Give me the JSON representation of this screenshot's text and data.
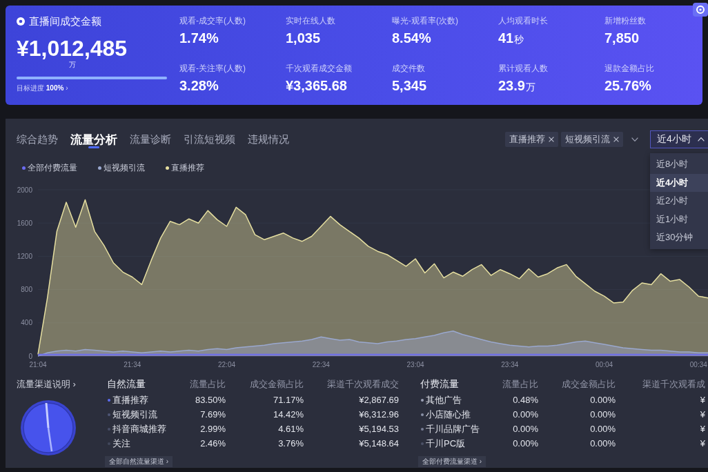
{
  "summary": {
    "title": "直播间成交金额",
    "value": "¥1,012,485",
    "unit": "万",
    "progress": {
      "level": 1.0
    },
    "goal_link": "目标进度 **100%** ›",
    "metrics": [
      {
        "label": "观看-成交率(人数)",
        "value": "1.74%"
      },
      {
        "label": "实时在线人数",
        "value": "1,035"
      },
      {
        "label": "曝光-观看率(次数)",
        "value": "8.54%"
      },
      {
        "label": "人均观看时长",
        "value": "41",
        "unit": "秒"
      },
      {
        "label": "新增粉丝数",
        "value": "7,850"
      },
      {
        "label": "观看-关注率(人数)",
        "value": "3.28%"
      },
      {
        "label": "千次观看成交金额",
        "value": "¥3,365.68"
      },
      {
        "label": "成交件数",
        "value": "5,345"
      },
      {
        "label": "累计观看人数",
        "value": "23.9",
        "unit": "万"
      },
      {
        "label": "退款金额占比",
        "value": "25.76%"
      }
    ]
  },
  "tabs": [
    {
      "label": "综合趋势",
      "selected": false
    },
    {
      "label": "流量分析",
      "selected": true
    },
    {
      "label": "流量诊断",
      "selected": false
    },
    {
      "label": "引流短视频",
      "selected": false
    },
    {
      "label": "违规情况",
      "selected": false
    }
  ],
  "filters": {
    "tags": [
      "直播推荐",
      "短视频引流"
    ]
  },
  "time_range": {
    "value": "近4小时",
    "expanded": true,
    "options": [
      {
        "label": "近8小时",
        "selected": false
      },
      {
        "label": "近4小时",
        "selected": true
      },
      {
        "label": "近2小时",
        "selected": false
      },
      {
        "label": "近1小时",
        "selected": false
      },
      {
        "label": "近30分钟",
        "selected": false
      }
    ]
  },
  "traffic_chart": {
    "chart_data": {
      "type": "area",
      "categories": [
        "21:04",
        null,
        null,
        null,
        null,
        null,
        null,
        null,
        null,
        null,
        "21:34",
        null,
        null,
        null,
        null,
        null,
        null,
        null,
        null,
        null,
        "22:04",
        null,
        null,
        null,
        null,
        null,
        null,
        null,
        null,
        null,
        "22:34",
        null,
        null,
        null,
        null,
        null,
        null,
        null,
        null,
        null,
        "23:04",
        null,
        null,
        null,
        null,
        null,
        null,
        null,
        null,
        null,
        "23:34",
        null,
        null,
        null,
        null,
        null,
        null,
        null,
        null,
        null,
        "00:04",
        null,
        null,
        null,
        null,
        null,
        null,
        null,
        null,
        null,
        "00:34",
        null
      ],
      "series": [
        {
          "name": "全部付费流量",
          "color": "#6c6cf2",
          "values": [
            20,
            20,
            20,
            20,
            20,
            20,
            20,
            20,
            20,
            20,
            20,
            20,
            20,
            20,
            20,
            20,
            20,
            20,
            20,
            20,
            20,
            20,
            20,
            20,
            20,
            20,
            20,
            20,
            20,
            20,
            20,
            20,
            20,
            20,
            20,
            20,
            20,
            20,
            20,
            20,
            20,
            20,
            20,
            20,
            20,
            20,
            20,
            20,
            20,
            20,
            20,
            20,
            20,
            20,
            20,
            20,
            20,
            20,
            20,
            20,
            20,
            20,
            20,
            20,
            20,
            20,
            20,
            20,
            20,
            20,
            20,
            20
          ]
        },
        {
          "name": "短视频引流",
          "color": "#9aa8cf",
          "values": [
            0,
            40,
            60,
            70,
            60,
            80,
            70,
            60,
            50,
            60,
            50,
            40,
            50,
            60,
            50,
            60,
            70,
            60,
            80,
            90,
            80,
            100,
            110,
            120,
            130,
            150,
            160,
            170,
            180,
            200,
            230,
            210,
            190,
            200,
            170,
            160,
            150,
            170,
            180,
            200,
            210,
            230,
            250,
            280,
            300,
            260,
            230,
            200,
            170,
            150,
            130,
            120,
            110,
            120,
            120,
            130,
            150,
            170,
            180,
            160,
            140,
            120,
            100,
            90,
            80,
            70,
            70,
            60,
            50,
            50,
            40,
            40
          ]
        },
        {
          "name": "直播推荐",
          "color": "#e6dfa0",
          "values": [
            20,
            700,
            1500,
            1850,
            1550,
            1880,
            1500,
            1330,
            1120,
            1010,
            950,
            860,
            1150,
            1420,
            1620,
            1580,
            1650,
            1600,
            1750,
            1640,
            1560,
            1790,
            1700,
            1460,
            1400,
            1440,
            1480,
            1420,
            1380,
            1440,
            1560,
            1680,
            1580,
            1500,
            1420,
            1320,
            1260,
            1220,
            1150,
            1080,
            1170,
            1000,
            1110,
            940,
            1010,
            960,
            1040,
            1100,
            970,
            1040,
            990,
            930,
            1050,
            950,
            990,
            1060,
            1100,
            960,
            870,
            780,
            720,
            640,
            650,
            790,
            880,
            860,
            990,
            900,
            920,
            830,
            720,
            700
          ]
        }
      ],
      "ylim": [
        0,
        2000
      ],
      "yticks": [
        0,
        400,
        800,
        1200,
        1600,
        2000
      ],
      "grid": true
    }
  },
  "channels": {
    "guide_link": "流量渠道说明 ›",
    "natural": {
      "columns": [
        "自然流量",
        "流量占比",
        "成交金额占比",
        "渠道千次观看成交"
      ],
      "rows": [
        {
          "color": "#5d6cf0",
          "cells": [
            "直播推荐",
            "83.50%",
            "71.17%",
            "¥2,867.69"
          ]
        },
        {
          "color": "#4f5676",
          "cells": [
            "短视频引流",
            "7.69%",
            "14.42%",
            "¥6,312.96"
          ]
        },
        {
          "color": "#484e68",
          "cells": [
            "抖音商城推荐",
            "2.99%",
            "4.61%",
            "¥5,194.53"
          ]
        },
        {
          "color": "#42475c",
          "cells": [
            "关注",
            "2.46%",
            "3.76%",
            "¥5,148.64"
          ]
        }
      ],
      "more_link": "全部自然流量渠道 ›"
    },
    "paid": {
      "columns": [
        "付费流量",
        "流量占比",
        "成交金额占比",
        "渠道千次观看成"
      ],
      "rows": [
        {
          "color": "#9ca1b6",
          "cells": [
            "其他广告",
            "0.48%",
            "0.00%",
            "¥"
          ]
        },
        {
          "color": "#8a90a6",
          "cells": [
            "小店随心推",
            "0.00%",
            "0.00%",
            "¥"
          ]
        },
        {
          "color": "#787e95",
          "cells": [
            "千川品牌广告",
            "0.00%",
            "0.00%",
            "¥"
          ]
        },
        {
          "color": "#4c5166",
          "cells": [
            "千川PC版",
            "0.00%",
            "0.00%",
            "¥"
          ]
        }
      ],
      "more_link": "全部付费流量渠道 ›"
    }
  }
}
